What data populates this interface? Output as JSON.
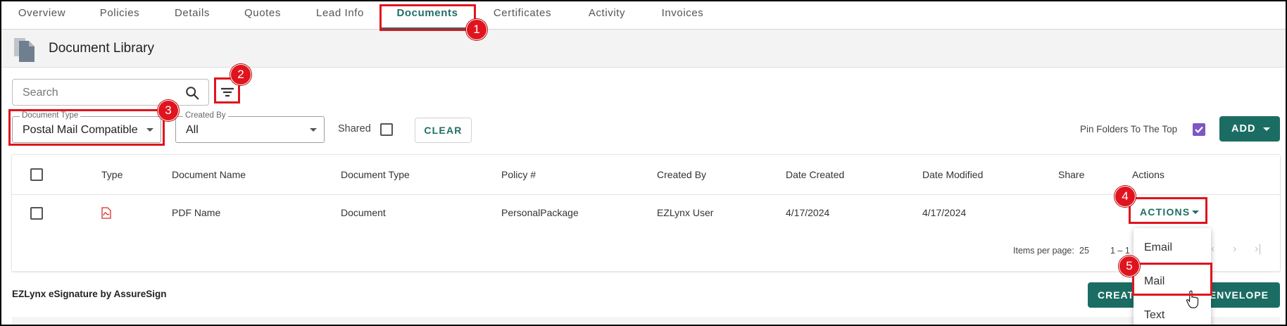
{
  "tabs": [
    {
      "label": "Overview"
    },
    {
      "label": "Policies"
    },
    {
      "label": "Details"
    },
    {
      "label": "Quotes"
    },
    {
      "label": "Lead Info"
    },
    {
      "label": "Documents",
      "active": true
    },
    {
      "label": "Certificates"
    },
    {
      "label": "Activity"
    },
    {
      "label": "Invoices"
    }
  ],
  "header": {
    "title": "Document Library",
    "icon": "documents-icon"
  },
  "search": {
    "placeholder": "Search",
    "value": ""
  },
  "filters": {
    "document_type": {
      "label": "Document Type",
      "value": "Postal Mail Compatible"
    },
    "created_by": {
      "label": "Created By",
      "value": "All"
    },
    "shared_label": "Shared",
    "clear_label": "CLEAR",
    "pin_folders_label": "Pin Folders To The Top",
    "pin_folders_checked": true,
    "add_label": "ADD"
  },
  "table": {
    "headers": [
      "Type",
      "Document Name",
      "Document Type",
      "Policy #",
      "Created By",
      "Date Created",
      "Date Modified",
      "Share",
      "Actions"
    ],
    "rows": [
      {
        "type_icon": "pdf-icon",
        "document_name": "PDF Name",
        "document_type": "Document",
        "policy": "PersonalPackage",
        "created_by": "EZLynx User",
        "date_created": "4/17/2024",
        "date_modified": "4/17/2024",
        "actions_label": "ACTIONS"
      }
    ],
    "pagination": {
      "items_per_page_label": "Items per page:",
      "items_per_page": "25",
      "range": "1 – 1"
    }
  },
  "actions_menu": [
    "Email",
    "Mail",
    "Text"
  ],
  "esign": {
    "title": "EZLynx eSignature by AssureSign",
    "create_left": "CREAT",
    "create_right": "ENVELOPE"
  },
  "callouts": [
    "1",
    "2",
    "3",
    "4",
    "5"
  ],
  "colors": {
    "accent": "#1b6d63",
    "highlight": "#e0141e",
    "checkbox_checked": "#7e57c2"
  }
}
